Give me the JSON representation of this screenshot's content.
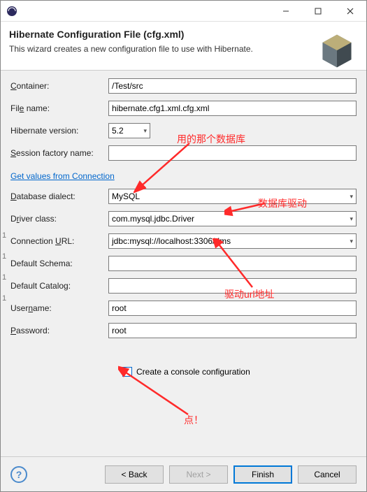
{
  "window": {
    "title": ""
  },
  "header": {
    "title": "Hibernate Configuration File (cfg.xml)",
    "subtitle": "This wizard creates a new configuration file to use with Hibernate."
  },
  "form": {
    "container_label": "Container:",
    "container_value": "/Test/src",
    "filename_label": "File name:",
    "filename_value": "hibernate.cfg1.xml.cfg.xml",
    "version_label": "Hibernate version:",
    "version_value": "5.2",
    "session_label": "Session factory name:",
    "session_value": "",
    "link_text": "Get values from Connection",
    "dialect_label": "Database dialect:",
    "dialect_value": "MySQL",
    "driver_label": "Driver class:",
    "driver_value": "com.mysql.jdbc.Driver",
    "connurl_label": "Connection URL:",
    "connurl_value": "jdbc:mysql://localhost:3306/dms",
    "schema_label": "Default Schema:",
    "schema_value": "",
    "catalog_label": "Default Catalog:",
    "catalog_value": "",
    "username_label": "Username:",
    "username_value": "root",
    "password_label": "Password:",
    "password_value": "root",
    "checkbox_label": "Create a console configuration"
  },
  "annotations": {
    "a1": "用的那个数据库",
    "a2": "数据库驱动",
    "a3": "驱动url地址",
    "a4": "点！"
  },
  "footer": {
    "back": "< Back",
    "next": "Next >",
    "finish": "Finish",
    "cancel": "Cancel"
  },
  "left_numbers": [
    "1",
    "1",
    "1",
    "1"
  ]
}
